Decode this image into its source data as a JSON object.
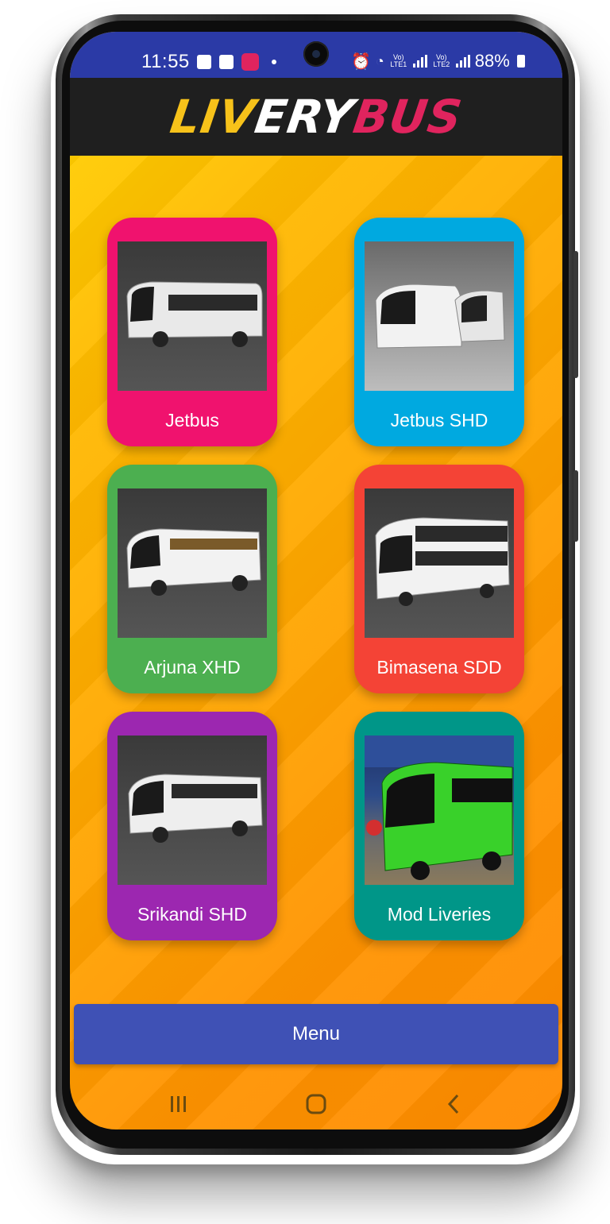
{
  "status_bar": {
    "time": "11:55",
    "sim1": "Vo)\nLTE1",
    "sim2": "Vo)\nLTE2",
    "battery": "88%"
  },
  "app_bar": {
    "logo": [
      "LIV",
      "ERY",
      "BUS"
    ]
  },
  "colors": {
    "status_bar": "#2b3aa6",
    "app_bar": "#1f1f1f",
    "menu_button": "#3f51b5"
  },
  "grid": {
    "items": [
      {
        "label": "Jetbus",
        "color": "#f0126e",
        "image": "bus-jetbus-image"
      },
      {
        "label": "Jetbus SHD",
        "color": "#00a9e0",
        "image": "bus-jetbus-shd-image"
      },
      {
        "label": "Arjuna XHD",
        "color": "#4caf50",
        "image": "bus-arjuna-xhd-image"
      },
      {
        "label": "Bimasena SDD",
        "color": "#f44336",
        "image": "bus-bimasena-sdd-image"
      },
      {
        "label": "Srikandi SHD",
        "color": "#9c27b0",
        "image": "bus-srikandi-shd-image"
      },
      {
        "label": "Mod Liveries",
        "color": "#009688",
        "image": "bus-mod-liveries-image"
      }
    ]
  },
  "menu": {
    "label": "Menu"
  },
  "nav": [
    "recents-icon",
    "home-icon",
    "back-icon"
  ]
}
